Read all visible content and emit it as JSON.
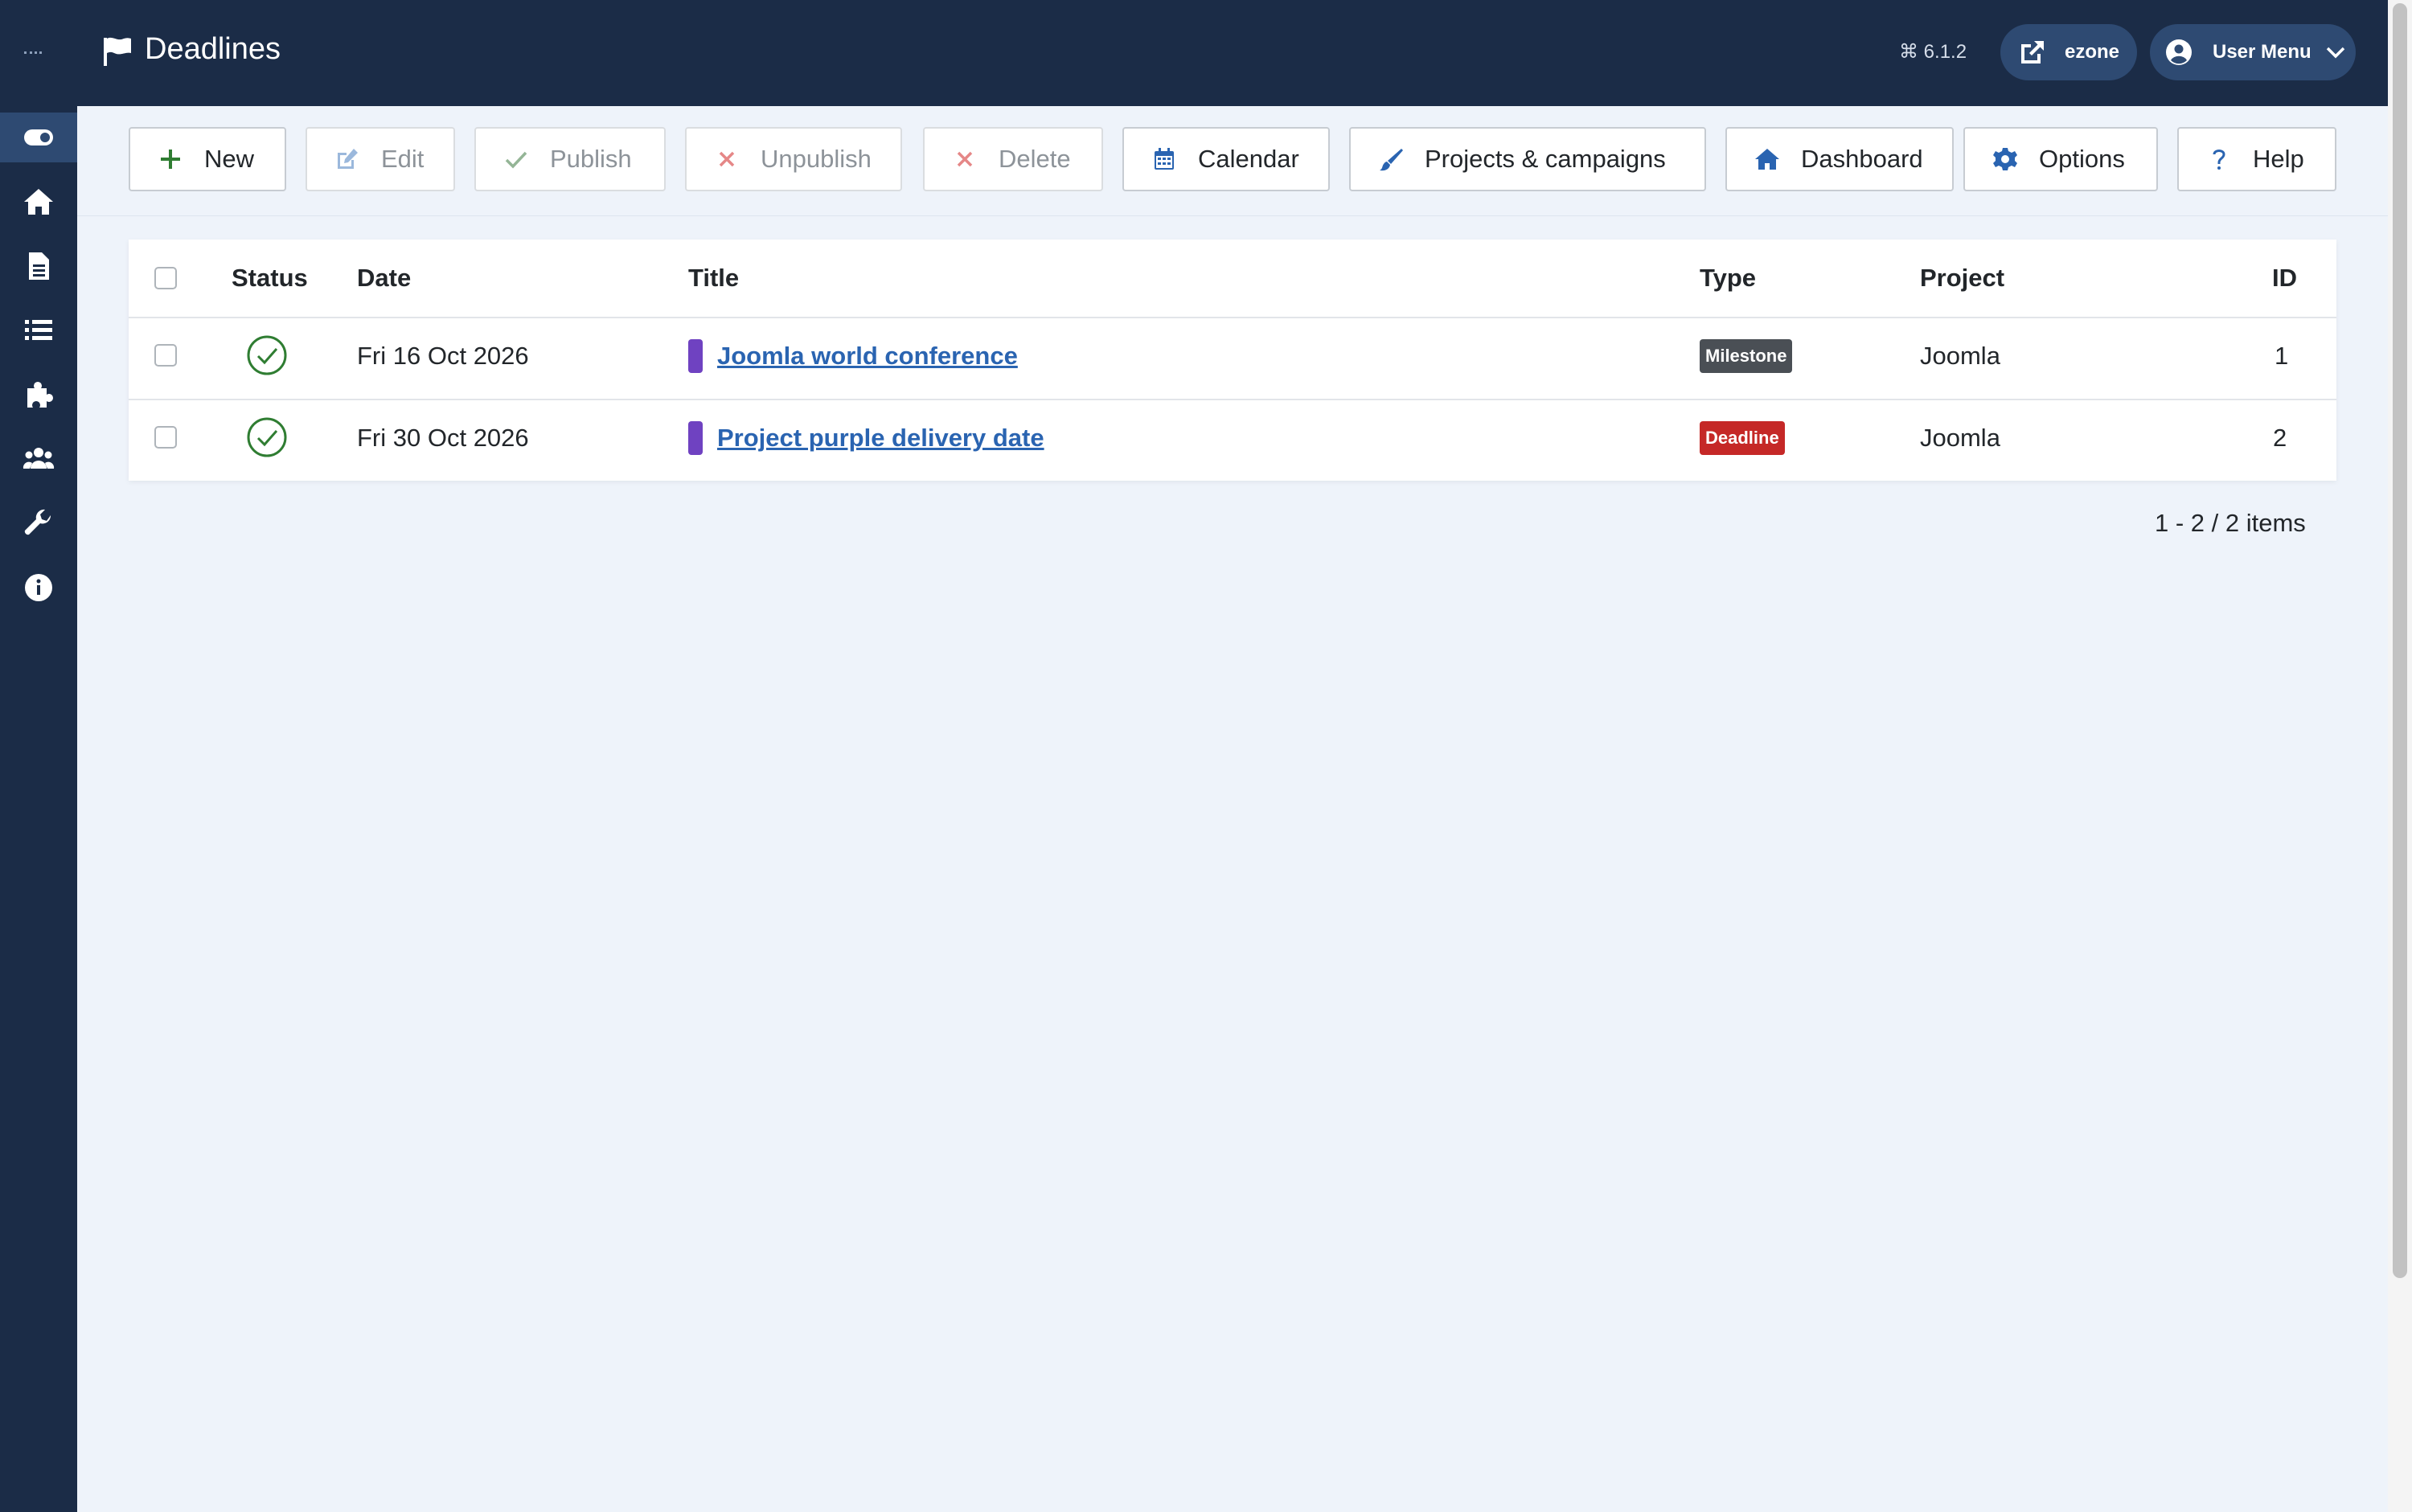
{
  "header": {
    "title": "Deadlines",
    "version": "6.1.2",
    "site_label": "ezone",
    "user_menu_label": "User Menu"
  },
  "sidebar": {
    "items": [
      {
        "icon": "toggle-menu-icon"
      },
      {
        "icon": "home-icon"
      },
      {
        "icon": "file-icon"
      },
      {
        "icon": "list-icon"
      },
      {
        "icon": "puzzle-icon"
      },
      {
        "icon": "users-icon"
      },
      {
        "icon": "wrench-icon"
      },
      {
        "icon": "info-icon"
      }
    ]
  },
  "toolbar": {
    "new_label": "New",
    "edit_label": "Edit",
    "publish_label": "Publish",
    "unpublish_label": "Unpublish",
    "delete_label": "Delete",
    "calendar_label": "Calendar",
    "projects_label": "Projects & campaigns",
    "dashboard_label": "Dashboard",
    "options_label": "Options",
    "help_label": "Help"
  },
  "table": {
    "columns": {
      "status": "Status",
      "date": "Date",
      "title": "Title",
      "type": "Type",
      "project": "Project",
      "id": "ID"
    },
    "rows": [
      {
        "date": "Fri 16 Oct 2026",
        "title": "Joomla world conference",
        "type": "Milestone",
        "type_color": "#4a4f55",
        "project": "Joomla",
        "id": "1",
        "category_color": "#6f42c1"
      },
      {
        "date": "Fri 30 Oct 2026",
        "title": "Project purple delivery date",
        "type": "Deadline",
        "type_color": "#c52827",
        "project": "Joomla",
        "id": "2",
        "category_color": "#6f42c1"
      }
    ]
  },
  "pagination": {
    "summary": "1 - 2 / 2 items"
  },
  "colors": {
    "header_bg": "#1b2c47",
    "link": "#2a64b1",
    "status_ok": "#2f7d32"
  }
}
